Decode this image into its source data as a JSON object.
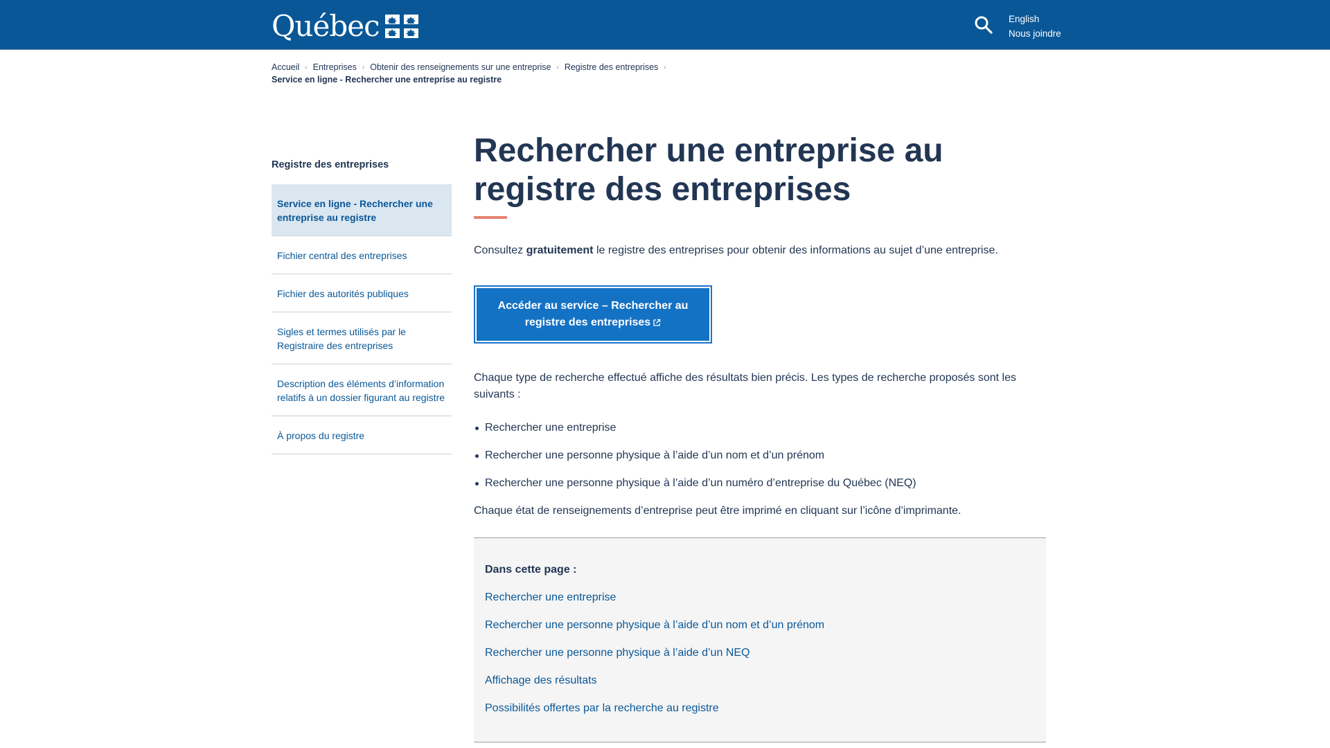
{
  "header": {
    "logo_text": "Québec",
    "links": [
      "English",
      "Nous joindre"
    ]
  },
  "breadcrumb": {
    "items": [
      "Accueil",
      "Entreprises",
      "Obtenir des renseignements sur une entreprise",
      "Registre des entreprises"
    ],
    "current": "Service en ligne - Rechercher une entreprise au registre"
  },
  "sidebar": {
    "title": "Registre des entreprises",
    "items": [
      {
        "label": "Service en ligne - Rechercher une entreprise au registre",
        "active": true
      },
      {
        "label": "Fichier central des entreprises"
      },
      {
        "label": "Fichier des autorités publiques"
      },
      {
        "label": "Sigles et termes utilisés par le Registraire des entreprises"
      },
      {
        "label": "Description des éléments d’information relatifs à un dossier figurant au registre"
      },
      {
        "label": "À propos du registre"
      }
    ]
  },
  "main": {
    "title": "Rechercher une entreprise au registre des entreprises",
    "intro_before": "Consultez ",
    "intro_bold": "gratuitement",
    "intro_after": " le registre des entreprises pour obtenir des informations au sujet d’une entreprise.",
    "cta_line1": "Accéder au service – Rechercher au",
    "cta_line2": "registre des entreprises",
    "paragraph": "Chaque type de recherche effectué affiche des résultats bien précis. Les types de recherche proposés sont les suivants :",
    "bullets": [
      "Rechercher une entreprise",
      "Rechercher une personne physique à l’aide d’un nom et d’un prénom",
      "Rechercher une personne physique à l’aide d’un numéro d’entreprise du Québec (NEQ)"
    ],
    "paragraph2": "Chaque état de renseignements d’entreprise peut être imprimé en cliquant sur l’icône d’imprimante."
  },
  "toc": {
    "title": "Dans cette page :",
    "links": [
      "Rechercher une entreprise",
      "Rechercher une personne physique à l’aide d’un nom et d’un prénom",
      "Rechercher une personne physique à l’aide d’un NEQ",
      "Affichage des résultats",
      "Possibilités offertes par la recherche au registre"
    ]
  },
  "colors": {
    "header_bg": "#095797",
    "title_text": "#223654",
    "link": "#095797",
    "accent_bar": "#e58271",
    "cta_bg": "#1472c4",
    "active_nav_bg": "#dae6f0",
    "toc_bg": "#f5f5f5"
  },
  "icons": [
    "quebec-flag-icon",
    "search-icon",
    "chevron-left-icon",
    "external-link-icon"
  ]
}
